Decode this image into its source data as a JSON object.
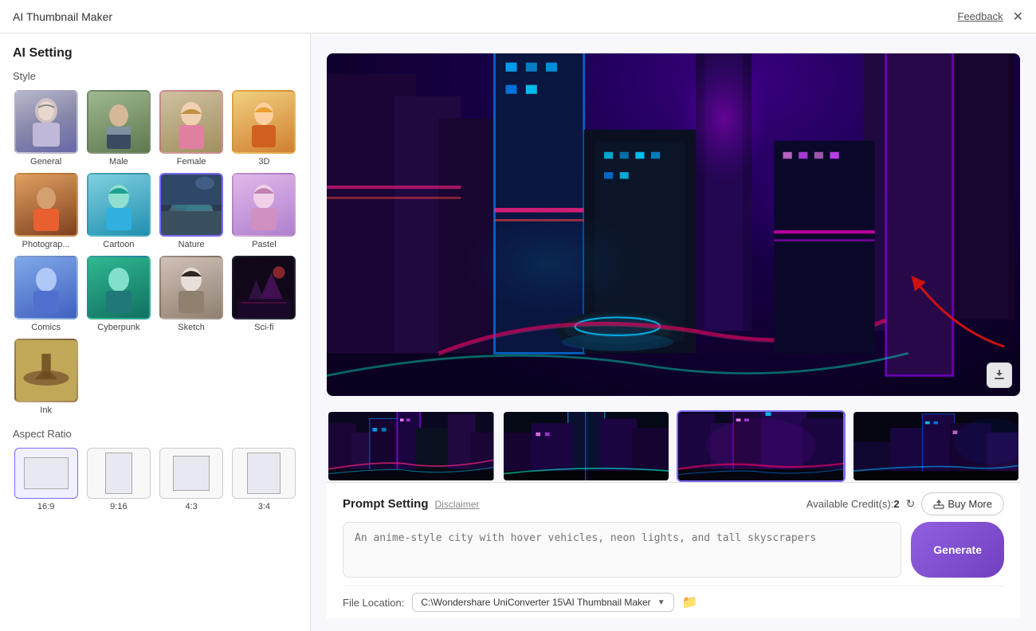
{
  "titleBar": {
    "title": "AI Thumbnail Maker",
    "feedbackLabel": "Feedback",
    "closeIcon": "✕"
  },
  "sidebar": {
    "settingsTitle": "AI Setting",
    "styleTitle": "Style",
    "styles": [
      {
        "id": "general",
        "label": "General",
        "selected": false,
        "emoji": "👩"
      },
      {
        "id": "male",
        "label": "Male",
        "selected": false,
        "emoji": "🧑"
      },
      {
        "id": "female",
        "label": "Female",
        "selected": false,
        "emoji": "👱‍♀️"
      },
      {
        "id": "3d",
        "label": "3D",
        "selected": false,
        "emoji": "👧"
      },
      {
        "id": "photography",
        "label": "Photograp...",
        "selected": false,
        "emoji": "👩"
      },
      {
        "id": "cartoon",
        "label": "Cartoon",
        "selected": false,
        "emoji": "🧝"
      },
      {
        "id": "nature",
        "label": "Nature",
        "selected": true,
        "emoji": "🏔️"
      },
      {
        "id": "pastel",
        "label": "Pastel",
        "selected": false,
        "emoji": "👸"
      },
      {
        "id": "comics",
        "label": "Comics",
        "selected": false,
        "emoji": "🦸"
      },
      {
        "id": "cyberpunk",
        "label": "Cyberpunk",
        "selected": false,
        "emoji": "🦸‍♀️"
      },
      {
        "id": "sketch",
        "label": "Sketch",
        "selected": false,
        "emoji": "👩"
      },
      {
        "id": "scifi",
        "label": "Sci-fi",
        "selected": false,
        "emoji": "🌌"
      },
      {
        "id": "ink",
        "label": "Ink",
        "selected": false,
        "emoji": "🏛️"
      }
    ],
    "aspectRatioTitle": "Aspect Ratio",
    "aspectRatios": [
      {
        "id": "16-9",
        "label": "16:9",
        "selected": true,
        "w": 56,
        "h": 40
      },
      {
        "id": "9-16",
        "label": "9:16",
        "selected": false,
        "w": 34,
        "h": 52
      },
      {
        "id": "4-3",
        "label": "4:3",
        "selected": false,
        "w": 46,
        "h": 44
      },
      {
        "id": "3-4",
        "label": "3:4",
        "selected": false,
        "w": 42,
        "h": 52
      }
    ]
  },
  "main": {
    "downloadIconTitle": "download",
    "thumbnails": [
      {
        "id": "thumb1",
        "active": false
      },
      {
        "id": "thumb2",
        "active": false
      },
      {
        "id": "thumb3",
        "active": true
      },
      {
        "id": "thumb4",
        "active": false
      }
    ],
    "promptSection": {
      "title": "Prompt Setting",
      "disclaimerLabel": "Disclaimer",
      "creditsLabel": "Available Credit(s):",
      "creditsValue": "2",
      "buyMoreLabel": "Buy More",
      "promptPlaceholder": "An anime-style city with hover vehicles, neon lights, and tall skyscrapers",
      "generateLabel": "Generate"
    },
    "fileLocation": {
      "label": "File Location:",
      "path": "C:\\Wondershare UniConverter 15\\AI Thumbnail Maker",
      "folderIcon": "📁"
    }
  }
}
